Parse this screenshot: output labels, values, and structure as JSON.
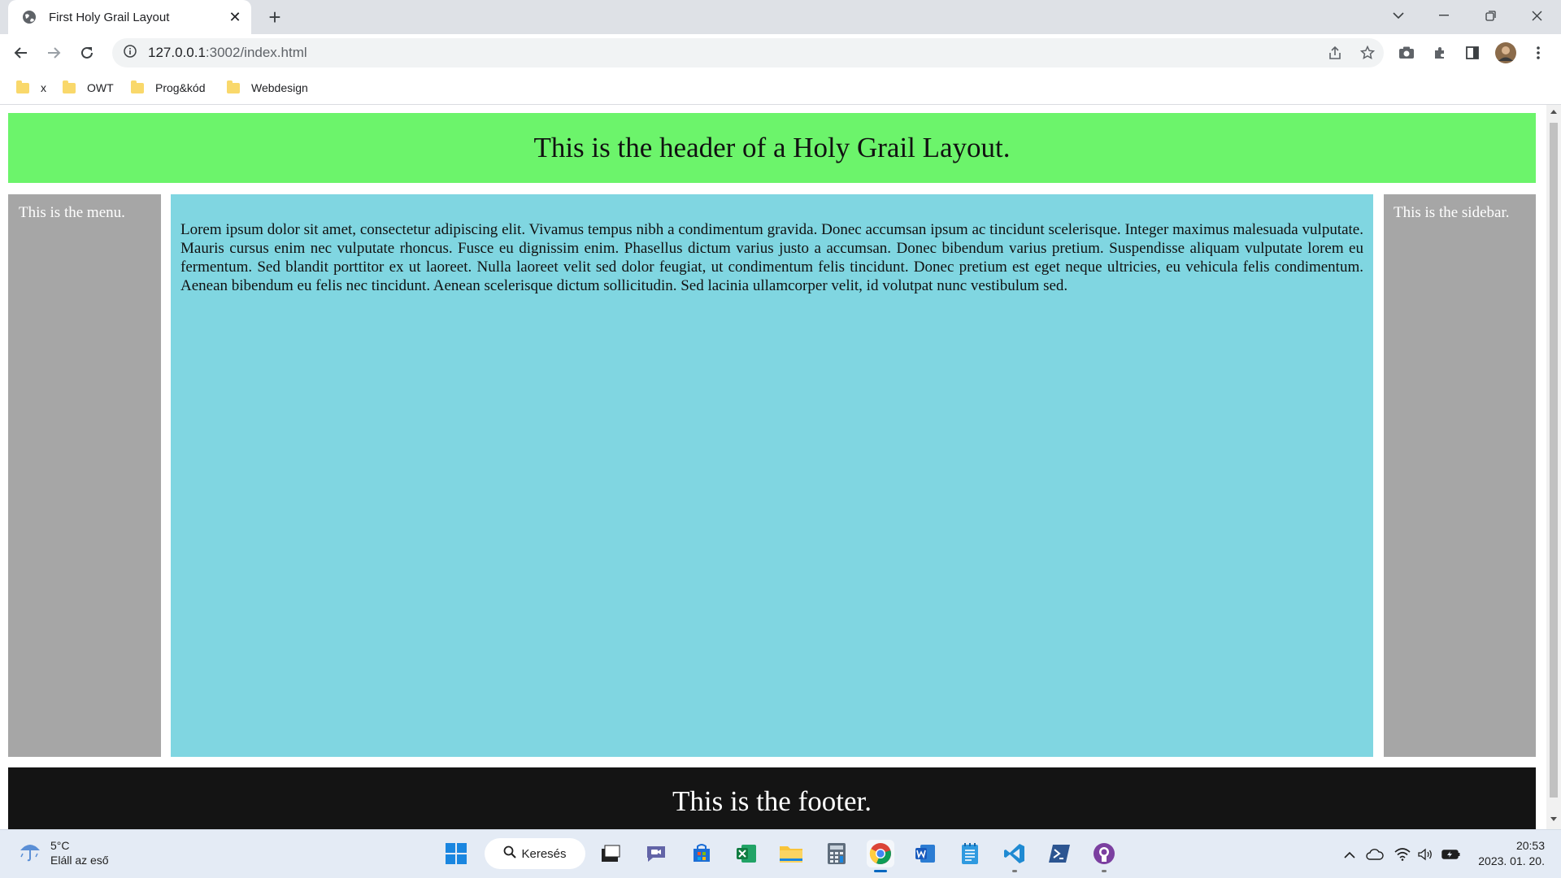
{
  "browser": {
    "tab_title": "First Holy Grail Layout",
    "url_host": "127.0.0.1",
    "url_path": ":3002/index.html",
    "bookmarks": [
      "x",
      "OWT",
      "Prog&kód",
      "Webdesign"
    ]
  },
  "page": {
    "header": "This is the header of a Holy Grail Layout.",
    "menu": "This is the menu.",
    "main": "Lorem ipsum dolor sit amet, consectetur adipiscing elit. Vivamus tempus nibh a condimentum gravida. Donec accumsan ipsum ac tincidunt scelerisque. Integer maximus malesuada vulputate. Mauris cursus enim nec vulputate rhoncus. Fusce eu dignissim enim. Phasellus dictum varius justo a accumsan. Donec bibendum varius pretium. Suspendisse aliquam vulputate lorem eu fermentum. Sed blandit porttitor ex ut laoreet. Nulla laoreet velit sed dolor feugiat, ut condimentum felis tincidunt. Donec pretium est eget neque ultricies, eu vehicula felis condimentum. Aenean bibendum eu felis nec tincidunt. Aenean scelerisque dictum sollicitudin. Sed lacinia ullamcorper velit, id volutpat nunc vestibulum sed.",
    "sidebar": "This is the sidebar.",
    "footer": "This is the footer."
  },
  "taskbar": {
    "weather_temp": "5°C",
    "weather_desc": "Eláll az eső",
    "search_label": "Keresés",
    "time": "20:53",
    "date": "2023. 01. 20."
  },
  "colors": {
    "header": "#6cf46b",
    "sidebars": "#a6a6a6",
    "main": "#80d6e1",
    "footer": "#141414"
  }
}
